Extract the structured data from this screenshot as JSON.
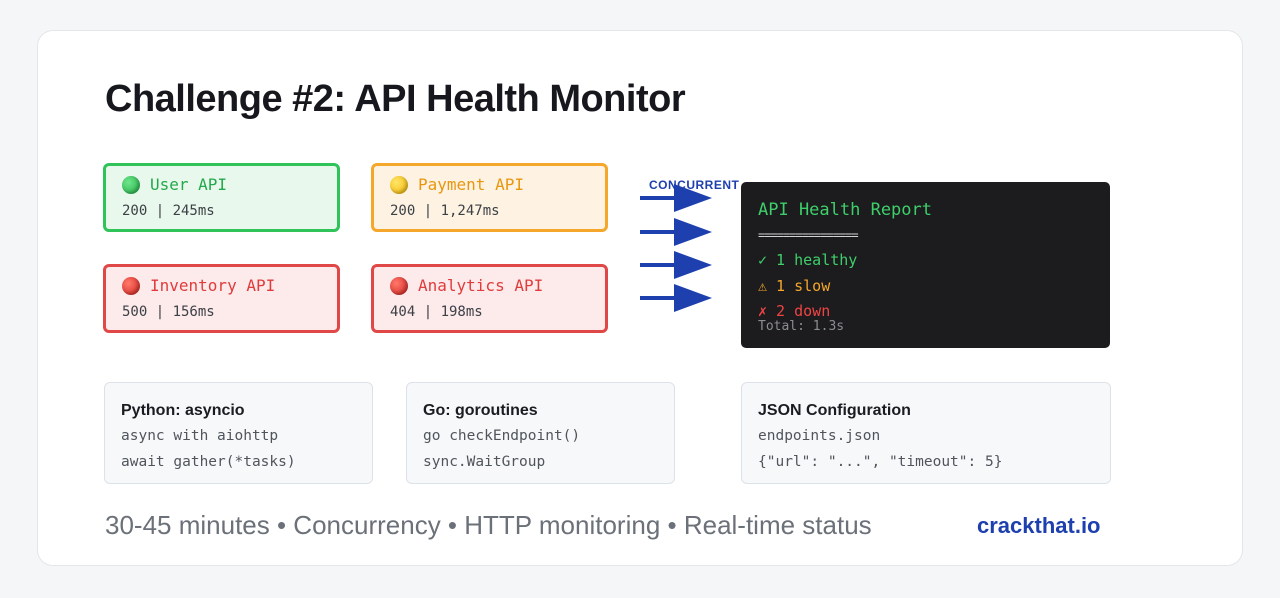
{
  "title": "Challenge #2: API Health Monitor",
  "apis": [
    {
      "name": "User API",
      "stats": "200 | 245ms",
      "status": "green"
    },
    {
      "name": "Payment API",
      "stats": "200 | 1,247ms",
      "status": "yellow"
    },
    {
      "name": "Inventory API",
      "stats": "500 | 156ms",
      "status": "red"
    },
    {
      "name": "Analytics API",
      "stats": "404 | 198ms",
      "status": "red"
    }
  ],
  "concurrent_label": "CONCURRENT",
  "report": {
    "title": "API Health Report",
    "rule": "================",
    "healthy": "✓ 1 healthy",
    "slow": "⚠ 1 slow",
    "down": "✗ 2 down",
    "total": "Total: 1.3s"
  },
  "info_boxes": [
    {
      "title": "Python: asyncio",
      "line1": "async with aiohttp",
      "line2": "await gather(*tasks)"
    },
    {
      "title": "Go: goroutines",
      "line1": "go checkEndpoint()",
      "line2": "sync.WaitGroup"
    },
    {
      "title": "JSON Configuration",
      "line1": "endpoints.json",
      "line2": "{\"url\": \"...\", \"timeout\": 5}"
    }
  ],
  "footer": "30-45 minutes • Concurrency • HTTP monitoring • Real-time status",
  "brand": "crackthat.io",
  "colors": {
    "healthy": "#2fc35a",
    "slow": "#f4a72a",
    "down": "#e04848",
    "accent": "#1e40af",
    "terminal_bg": "#1c1c1e"
  }
}
